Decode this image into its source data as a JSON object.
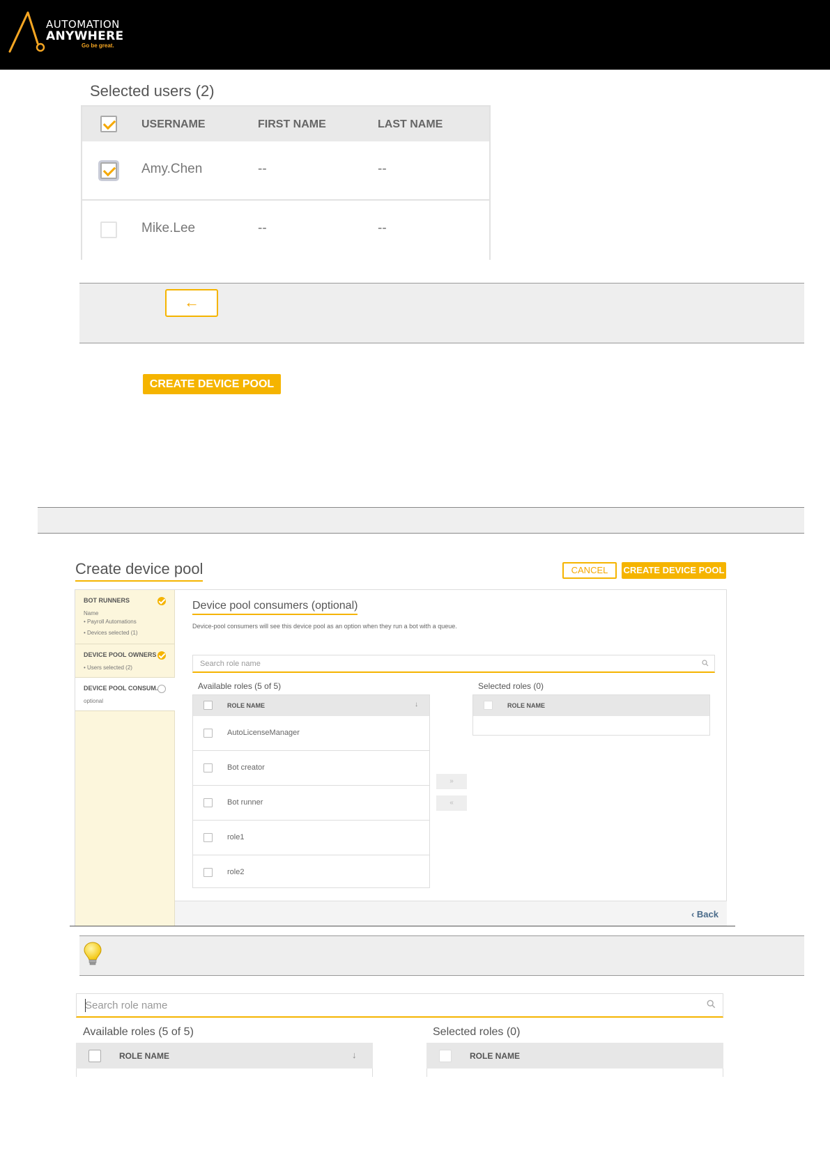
{
  "brand": {
    "line1": "AUTOMATION",
    "line2": "ANYWHERE",
    "tagline": "Go be great."
  },
  "selected_users": {
    "heading": "Selected users (2)",
    "columns": [
      "USERNAME",
      "FIRST NAME",
      "LAST NAME"
    ],
    "rows": [
      {
        "username": "Amy.Chen",
        "first": "--",
        "last": "--",
        "checked": true
      },
      {
        "username": "Mike.Lee",
        "first": "--",
        "last": "--",
        "checked": false
      }
    ]
  },
  "note": {
    "arrow": "←"
  },
  "create_button_large": "CREATE DEVICE POOL",
  "wizard": {
    "title": "Create device pool",
    "cancel_label": "CANCEL",
    "create_label": "CREATE DEVICE POOL",
    "steps": [
      {
        "title": "BOT RUNNERS",
        "lines": [
          "Name",
          "• Payroll Automations",
          "• Devices selected (1)"
        ]
      },
      {
        "title": "DEVICE POOL OWNERS",
        "lines": [
          "• Users selected (2)"
        ]
      },
      {
        "title": "DEVICE POOL CONSUM...",
        "lines": [
          "optional"
        ]
      }
    ],
    "section_title": "Device pool consumers (optional)",
    "section_desc": "Device-pool consumers will see this device pool as an option when they run a bot with a queue.",
    "search_placeholder": "Search role name",
    "available_label": "Available roles (5 of 5)",
    "selected_label": "Selected roles (0)",
    "role_column": "ROLE NAME",
    "roles": [
      "AutoLicenseManager",
      "Bot creator",
      "Bot runner",
      "role1",
      "role2"
    ],
    "move_right": "»",
    "move_left": "«",
    "back_label": "‹ Back"
  },
  "zoomed": {
    "search_placeholder": "Search role name",
    "available_label": "Available roles (5 of 5)",
    "selected_label": "Selected roles (0)",
    "role_column": "ROLE NAME"
  },
  "icons": {
    "logo": "automation-anywhere-logo",
    "search": "search-icon",
    "sort": "sort-icon",
    "tip": "lightbulb-icon"
  },
  "colors": {
    "accent": "#f5b400",
    "header": "#000000",
    "sidebar": "#fcf6dc"
  }
}
